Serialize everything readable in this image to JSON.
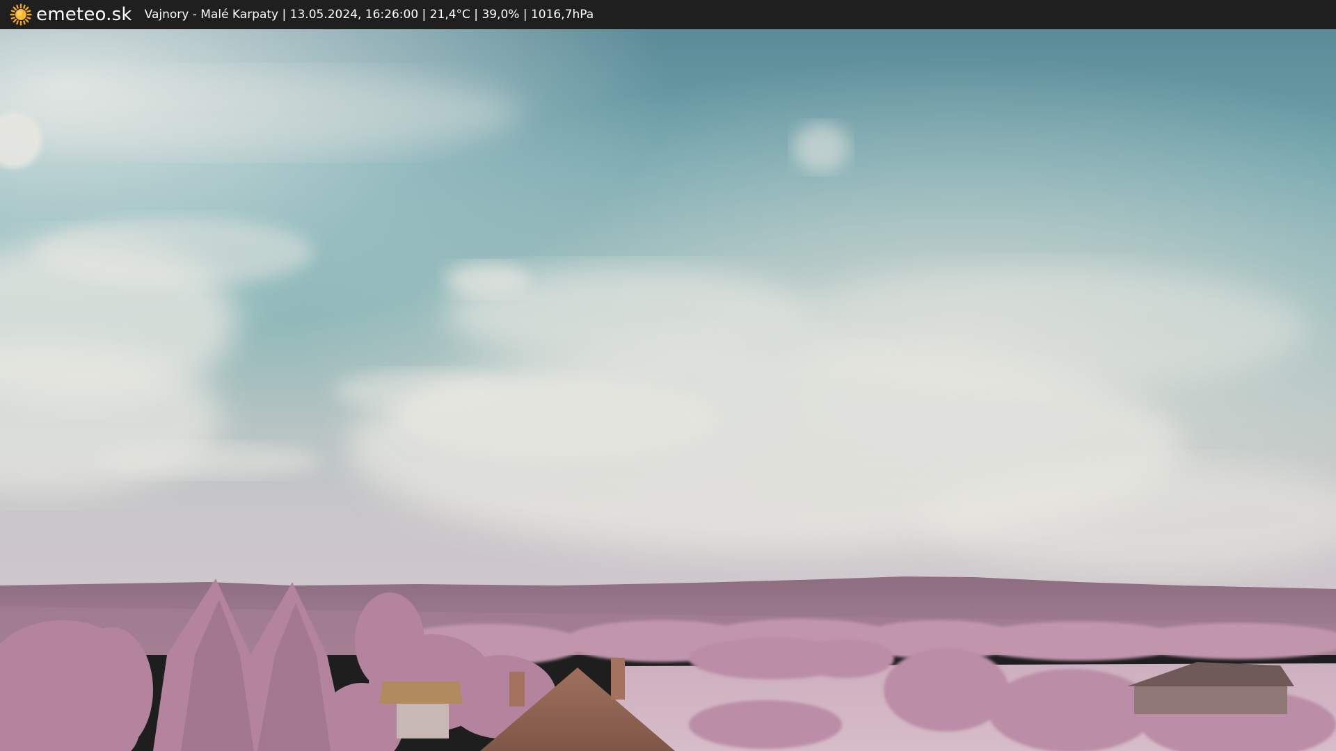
{
  "header": {
    "logo_text": "emeteo.sk",
    "logo_icon": "sun-icon",
    "caption": "Vajnory - Malé Karpaty | 13.05.2024, 16:26:00 | 21,4°C | 39,0% | 1016,7hPa"
  },
  "colors": {
    "bar_background": "#1f1f1f",
    "sun_orange": "#f5a623",
    "sky_top": "#5f8f9a",
    "sky_mid": "#79b3b8",
    "horizon": "#c9c7c8",
    "foliage": "#b88aa4",
    "roof": "#9a6e5a"
  }
}
